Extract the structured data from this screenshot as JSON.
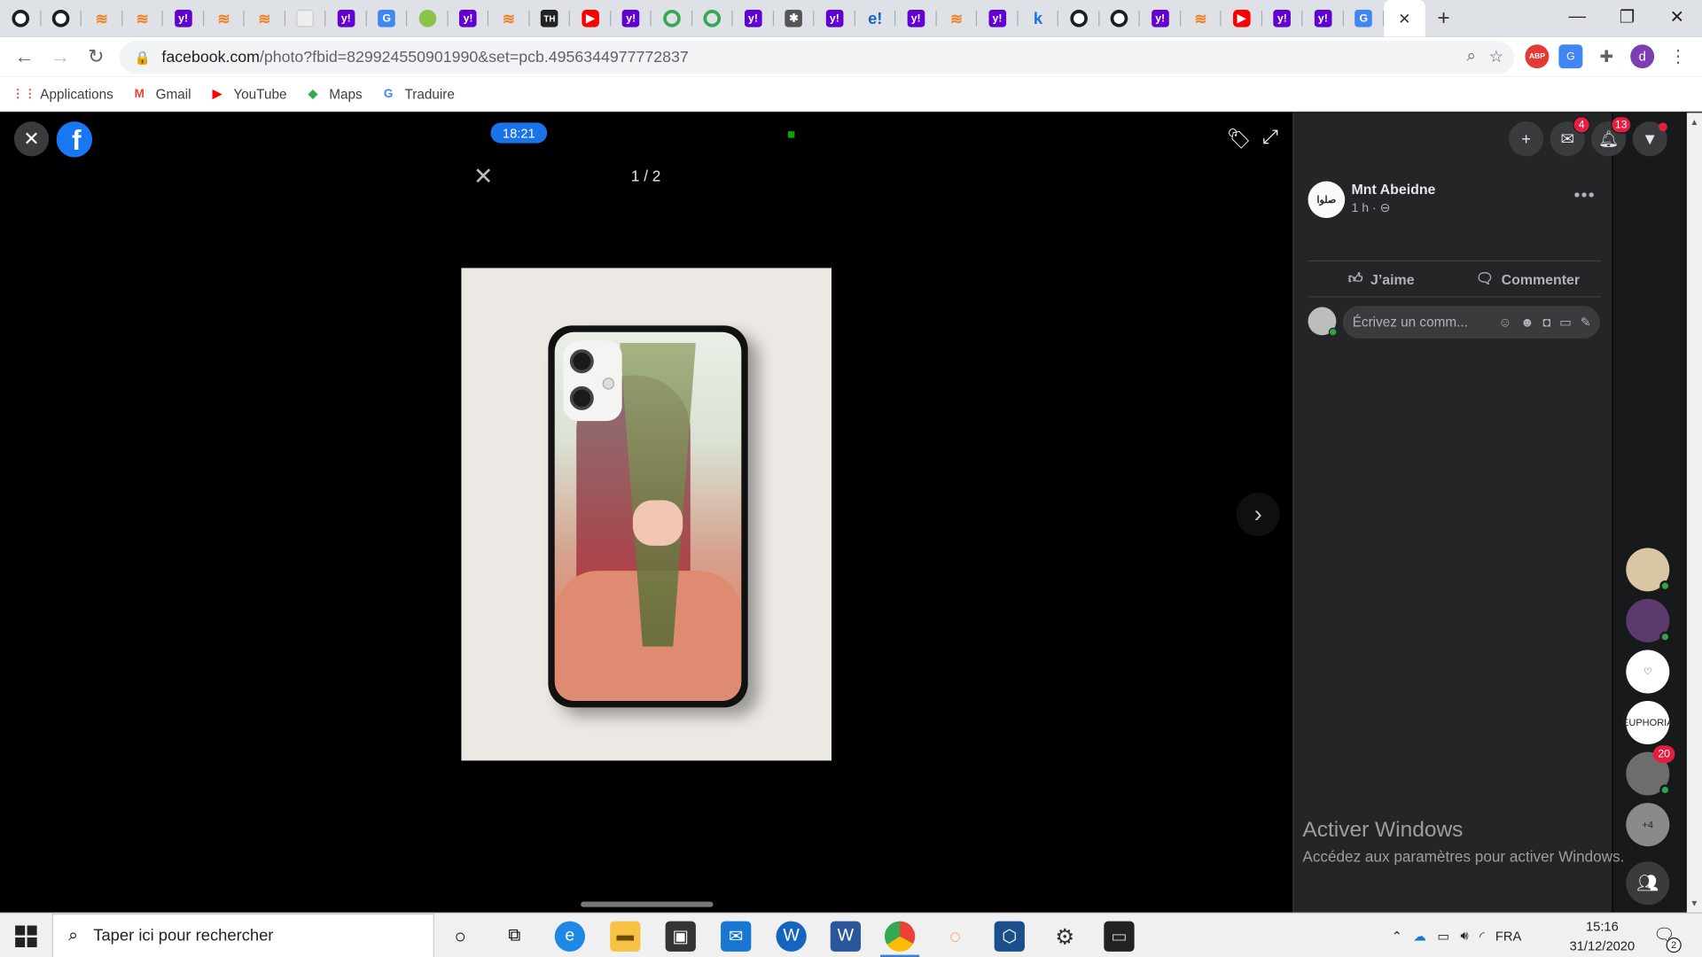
{
  "browser": {
    "tabs": [
      {
        "icon": "github-icon",
        "glyph": "",
        "cls": "gh"
      },
      {
        "icon": "github-icon",
        "glyph": "",
        "cls": "gh"
      },
      {
        "icon": "stackoverflow-icon",
        "glyph": "≋",
        "cls": "so"
      },
      {
        "icon": "stackoverflow-icon",
        "glyph": "≋",
        "cls": "so"
      },
      {
        "icon": "yahoo-icon",
        "glyph": "y!",
        "cls": "y"
      },
      {
        "icon": "stackoverflow-icon",
        "glyph": "≋",
        "cls": "so"
      },
      {
        "icon": "stackoverflow-icon",
        "glyph": "≋",
        "cls": "so"
      },
      {
        "icon": "page-icon",
        "glyph": "",
        "cls": "gray"
      },
      {
        "icon": "yahoo-icon",
        "glyph": "y!",
        "cls": "y"
      },
      {
        "icon": "google-translate-icon",
        "glyph": "G",
        "cls": "gt"
      },
      {
        "icon": "green-circle-icon",
        "glyph": "",
        "cls": "grn"
      },
      {
        "icon": "yahoo-icon",
        "glyph": "y!",
        "cls": "y"
      },
      {
        "icon": "stackoverflow-icon",
        "glyph": "≋",
        "cls": "so"
      },
      {
        "icon": "th-icon",
        "glyph": "TH",
        "cls": "th"
      },
      {
        "icon": "youtube-icon",
        "glyph": "▶",
        "cls": "yt"
      },
      {
        "icon": "yahoo-icon",
        "glyph": "y!",
        "cls": "y"
      },
      {
        "icon": "ring-icon",
        "glyph": "",
        "cls": "ring"
      },
      {
        "icon": "ring-icon",
        "glyph": "",
        "cls": "ring"
      },
      {
        "icon": "yahoo-icon",
        "glyph": "y!",
        "cls": "y"
      },
      {
        "icon": "paw-icon",
        "glyph": "✱",
        "cls": "paw"
      },
      {
        "icon": "yahoo-icon",
        "glyph": "y!",
        "cls": "y"
      },
      {
        "icon": "e-icon",
        "glyph": "e!",
        "cls": "e"
      },
      {
        "icon": "yahoo-icon",
        "glyph": "y!",
        "cls": "y"
      },
      {
        "icon": "stackoverflow-icon",
        "glyph": "≋",
        "cls": "so"
      },
      {
        "icon": "yahoo-icon",
        "glyph": "y!",
        "cls": "y"
      },
      {
        "icon": "k-icon",
        "glyph": "k",
        "cls": "k"
      },
      {
        "icon": "github-icon",
        "glyph": "",
        "cls": "gh"
      },
      {
        "icon": "github-icon",
        "glyph": "",
        "cls": "gh"
      },
      {
        "icon": "yahoo-icon",
        "glyph": "y!",
        "cls": "y"
      },
      {
        "icon": "stackoverflow-icon",
        "glyph": "≋",
        "cls": "so"
      },
      {
        "icon": "youtube-icon",
        "glyph": "▶",
        "cls": "yt"
      },
      {
        "icon": "yahoo-icon",
        "glyph": "y!",
        "cls": "y"
      },
      {
        "icon": "yahoo-icon",
        "glyph": "y!",
        "cls": "y"
      },
      {
        "icon": "google-translate-icon",
        "glyph": "G",
        "cls": "gt"
      }
    ],
    "active_tab_close": "✕",
    "new_tab": "+",
    "window_buttons": {
      "minimize": "—",
      "restore": "❐",
      "close": "✕"
    },
    "url_host": "facebook.com",
    "url_rest": "/photo?fbid=829924550901990&set=pcb.4956344977772837",
    "profile_initial": "d",
    "bookmarks": [
      {
        "label": "Applications",
        "icon": "apps-grid-icon",
        "glyph": "⋮⋮",
        "color": "#ea4335"
      },
      {
        "label": "Gmail",
        "icon": "gmail-icon",
        "glyph": "M",
        "color": "#ea4335"
      },
      {
        "label": "YouTube",
        "icon": "youtube-icon",
        "glyph": "▶",
        "color": "#ff0000"
      },
      {
        "label": "Maps",
        "icon": "maps-icon",
        "glyph": "◆",
        "color": "#34a853"
      },
      {
        "label": "Traduire",
        "icon": "google-translate-icon",
        "glyph": "G",
        "color": "#4285f4"
      }
    ]
  },
  "viewer": {
    "time": "18:21",
    "counter": "1 / 2"
  },
  "post": {
    "author": "Mnt Abeidne",
    "avatar_text": "صلوا",
    "meta": "1 h · ⊖",
    "like_label": "J’aime",
    "comment_label": "Commenter",
    "comment_placeholder": "Écrivez un comm..."
  },
  "header_badges": {
    "messenger": "4",
    "notifications": "13"
  },
  "contacts": [
    {
      "bg": "#d9c7a4",
      "online": true,
      "badge": "",
      "text": ""
    },
    {
      "bg": "#5b3a6e",
      "online": true,
      "badge": "",
      "text": ""
    },
    {
      "bg": "#ffffff",
      "online": false,
      "badge": "",
      "text": "♡"
    },
    {
      "bg": "#ffffff",
      "online": false,
      "badge": "",
      "text": "EUPHORIA"
    },
    {
      "bg": "#6d6d6d",
      "online": true,
      "badge": "20",
      "text": ""
    },
    {
      "bg": "#8a8a8a",
      "online": false,
      "badge": "",
      "text": "+4"
    }
  ],
  "watermark": {
    "title": "Activer Windows",
    "subtitle": "Accédez aux paramètres pour activer Windows."
  },
  "taskbar": {
    "search_placeholder": "Taper ici pour rechercher",
    "lang": "FRA",
    "time": "15:16",
    "date": "31/12/2020",
    "notification_count": "2"
  }
}
